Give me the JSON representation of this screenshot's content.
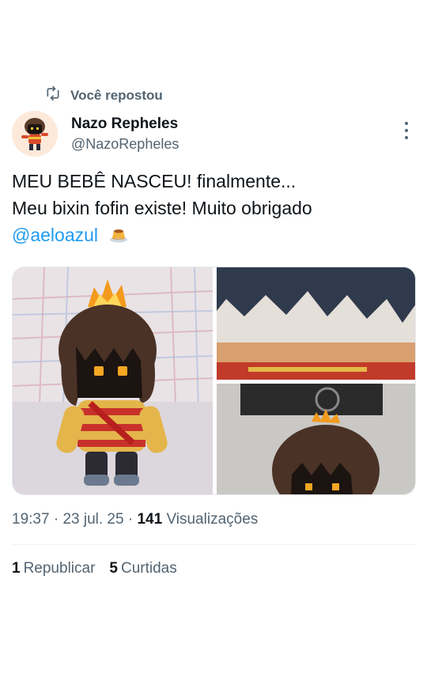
{
  "repost": {
    "icon": "repost-icon",
    "label": "Você repostou"
  },
  "author": {
    "name": "Nazo Repheles",
    "handle": "@NazoRepheles",
    "avatar": "avatar-icon"
  },
  "tweet": {
    "line1": "MEU BEBÊ NASCEU! finalmente...",
    "line2": "Meu bixin fofin existe! Muito obrigado",
    "mention": "@aeloazul",
    "emoji": "🍮"
  },
  "media": {
    "images": [
      "plush-full-photo",
      "plush-closeup-photo",
      "plush-keychain-photo"
    ]
  },
  "meta": {
    "time": "19:37",
    "sep1": "·",
    "date": "23 jul. 25",
    "sep2": "·",
    "views_count": "141",
    "views_label": "Visualizações"
  },
  "stats": {
    "reposts_count": "1",
    "reposts_label": "Republicar",
    "likes_count": "5",
    "likes_label": "Curtidas"
  },
  "colors": {
    "text": "#0f1419",
    "secondary": "#536471",
    "link": "#1d9bf0",
    "divider": "#eff3f4"
  }
}
